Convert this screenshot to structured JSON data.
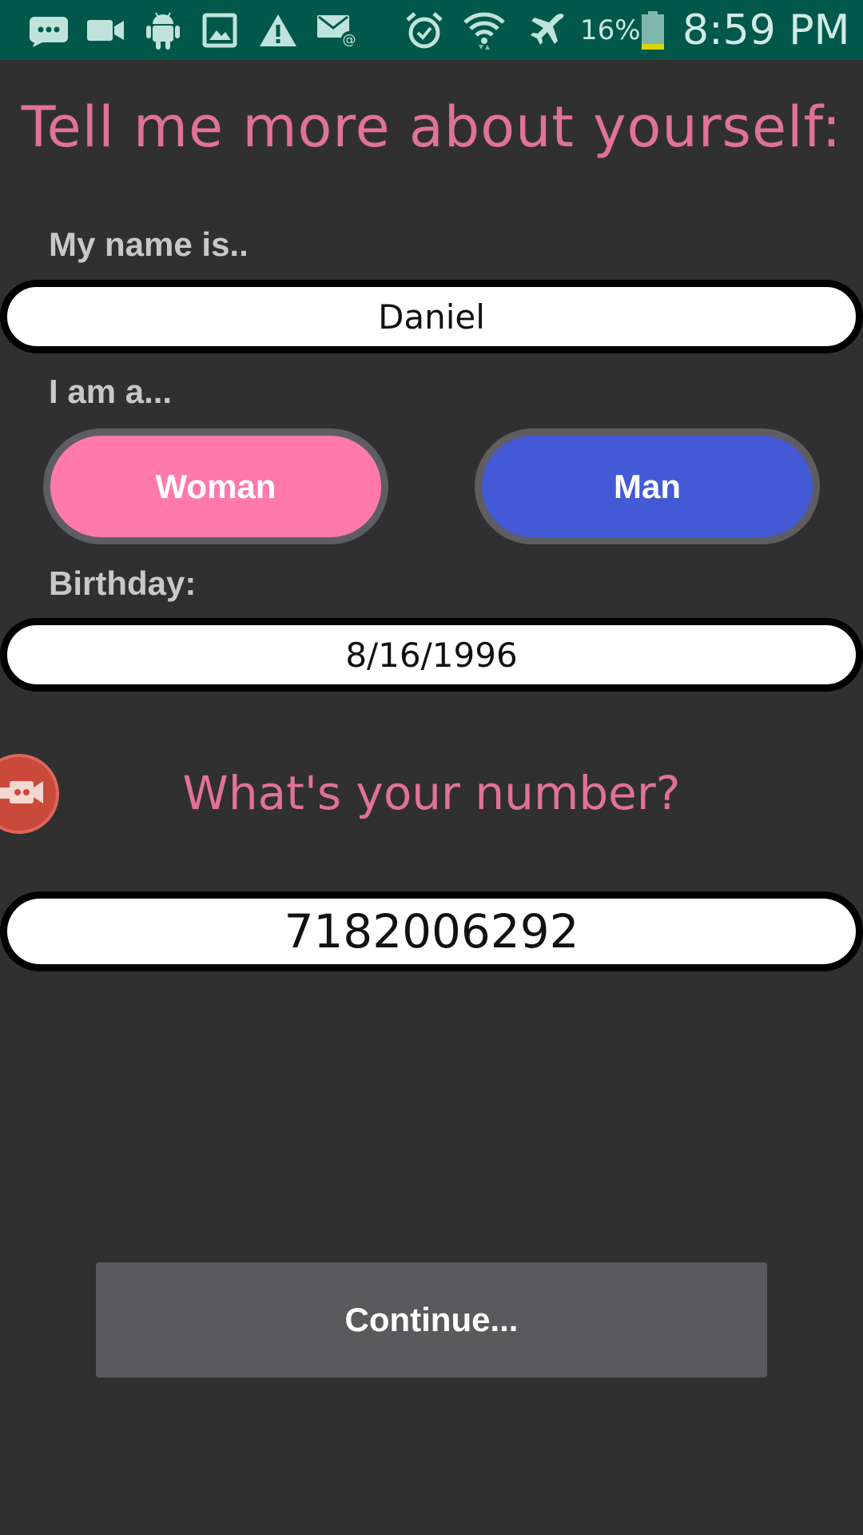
{
  "status_bar": {
    "icons": [
      "chat-bubble-icon",
      "video-camera-icon",
      "android-icon",
      "image-icon",
      "warning-icon",
      "email-at-icon",
      "alarm-icon",
      "wifi-icon",
      "airplane-mode-icon",
      "battery-icon"
    ],
    "battery_percent": "16%",
    "time": "8:59 PM",
    "color": "#00584a"
  },
  "form": {
    "title": "Tell me more about yourself:",
    "name_label": "My name is..",
    "name_value": "Daniel",
    "gender_label": "I am a...",
    "gender_options": [
      "Woman",
      "Man"
    ],
    "gender_colors": {
      "woman": "#ff7aab",
      "man": "#4459d6"
    },
    "birthday_label": "Birthday:",
    "birthday_value": "8/16/1996",
    "phone_prompt": "What's your number?",
    "phone_value": "7182006292",
    "continue_label": "Continue..."
  },
  "overlay": {
    "icon": "screen-record-icon"
  },
  "colors": {
    "background": "#303030",
    "accent_text": "#e07299"
  }
}
